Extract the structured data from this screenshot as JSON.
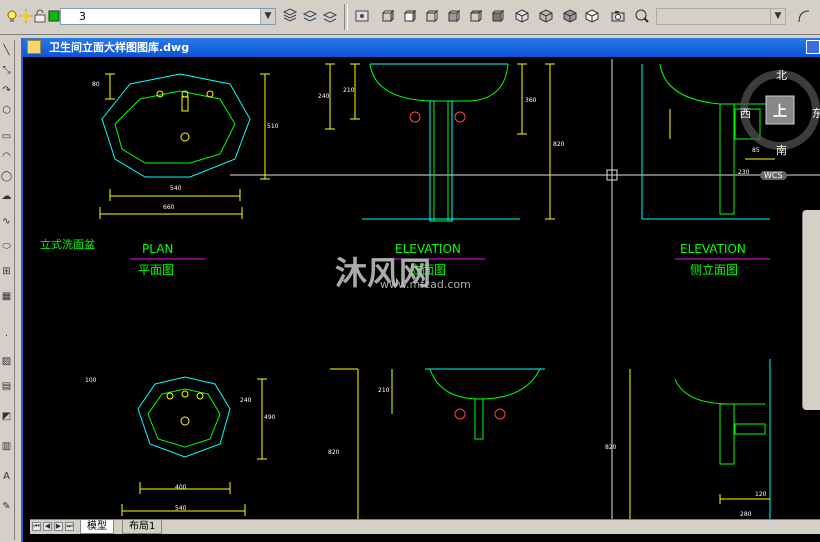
{
  "toolbar": {
    "layer_value": "3",
    "layer_icons": [
      "bulb-icon",
      "sun-icon",
      "lock-icon",
      "color-swatch-icon"
    ]
  },
  "window": {
    "title": "卫生间立面大样图图库.dwg"
  },
  "drawing": {
    "label_pedestal": "立式洗面盆",
    "plan_en": "PLAN",
    "plan_cn": "平面图",
    "elev1_en": "ELEVATION",
    "elev1_cn": "立面图",
    "elev2_en": "ELEVATION",
    "elev2_cn": "侧立面图",
    "dims": {
      "plan_w1": "540",
      "plan_w2": "660",
      "plan_h": "510",
      "plan_top": "80",
      "elev_h1": "240",
      "elev_h2": "210",
      "elev_h3": "360",
      "elev_total": "820",
      "side_85": "85",
      "side_230": "230",
      "plan2_w1": "400",
      "plan2_w2": "540",
      "plan2_h": "490",
      "plan2_h1": "240",
      "plan2_top": "100",
      "elev2_h": "210",
      "elev2_total": "820",
      "side2_120": "120",
      "side2_280": "280",
      "side2_820": "820"
    }
  },
  "viewcube": {
    "north": "北",
    "south": "南",
    "east": "东",
    "west": "西",
    "top": "上",
    "wcs": "WCS"
  },
  "tabs": {
    "model": "模型",
    "layout1": "布局1"
  },
  "watermark": {
    "brand": "沐风网",
    "url": "www.mfcad.com"
  },
  "colors": {
    "cad_background": "#000000",
    "cyan": "#00ffff",
    "green": "#00ff00",
    "yellow": "#ffff00",
    "magenta": "#ff00ff"
  }
}
